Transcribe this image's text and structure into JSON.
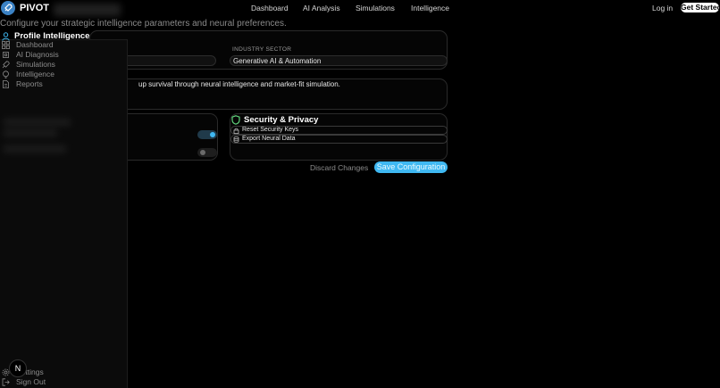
{
  "header": {
    "brand": "PIVOT",
    "nav": [
      "Dashboard",
      "AI Analysis",
      "Simulations",
      "Intelligence"
    ],
    "login": "Log in",
    "get_started": "Get Started"
  },
  "page": {
    "subtitle": "Configure your strategic intelligence parameters and neural preferences."
  },
  "sidebar": {
    "section_title": "Profile Intelligence",
    "items": [
      {
        "label": "Dashboard",
        "icon": "grid-icon"
      },
      {
        "label": "AI Diagnosis",
        "icon": "cpu-icon"
      },
      {
        "label": "Simulations",
        "icon": "rocket-icon"
      },
      {
        "label": "Intelligence",
        "icon": "bulb-icon"
      },
      {
        "label": "Reports",
        "icon": "document-icon"
      }
    ],
    "bottom_items": [
      {
        "label": "Settings",
        "icon": "gear-icon"
      },
      {
        "label": "Sign Out",
        "icon": "logout-icon"
      }
    ],
    "avatar_letter": "N"
  },
  "profile_card": {
    "industry_label": "INDUSTRY SECTOR",
    "industry_value": "Generative AI & Automation",
    "mission_text": "up survival through neural intelligence and market-fit simulation."
  },
  "preferences": {
    "toggle_1_on": true,
    "toggle_2_on": false
  },
  "security": {
    "title": "Security & Privacy",
    "reset_keys": "Reset Security Keys",
    "export_data": "Export Neural Data"
  },
  "actions": {
    "discard": "Discard Changes",
    "save": "Save Configuration"
  },
  "colors": {
    "accent": "#3fb8f2",
    "security_icon": "#5fd17a",
    "logo_bg": "#3b82c4"
  }
}
